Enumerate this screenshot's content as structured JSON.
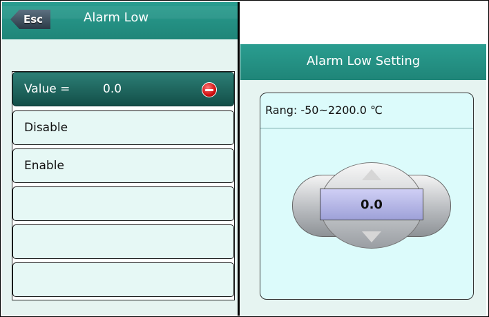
{
  "left": {
    "esc_label": "Esc",
    "title": "Alarm Low",
    "rows": [
      {
        "label": "Value =",
        "value": "0.0"
      },
      {
        "label": "Disable"
      },
      {
        "label": "Enable"
      },
      {
        "label": ""
      },
      {
        "label": ""
      },
      {
        "label": ""
      }
    ]
  },
  "right": {
    "title": "Alarm Low Setting",
    "range": "Rang: -50~2200.0 ℃",
    "value": "0.0"
  },
  "icons": {
    "minus": "minus-circle-icon",
    "up": "arrow-up-icon",
    "down": "arrow-down-icon"
  },
  "colors": {
    "header": "#1f8578",
    "selected_row": "#134e48",
    "panel_bg": "#e6f4f1"
  }
}
